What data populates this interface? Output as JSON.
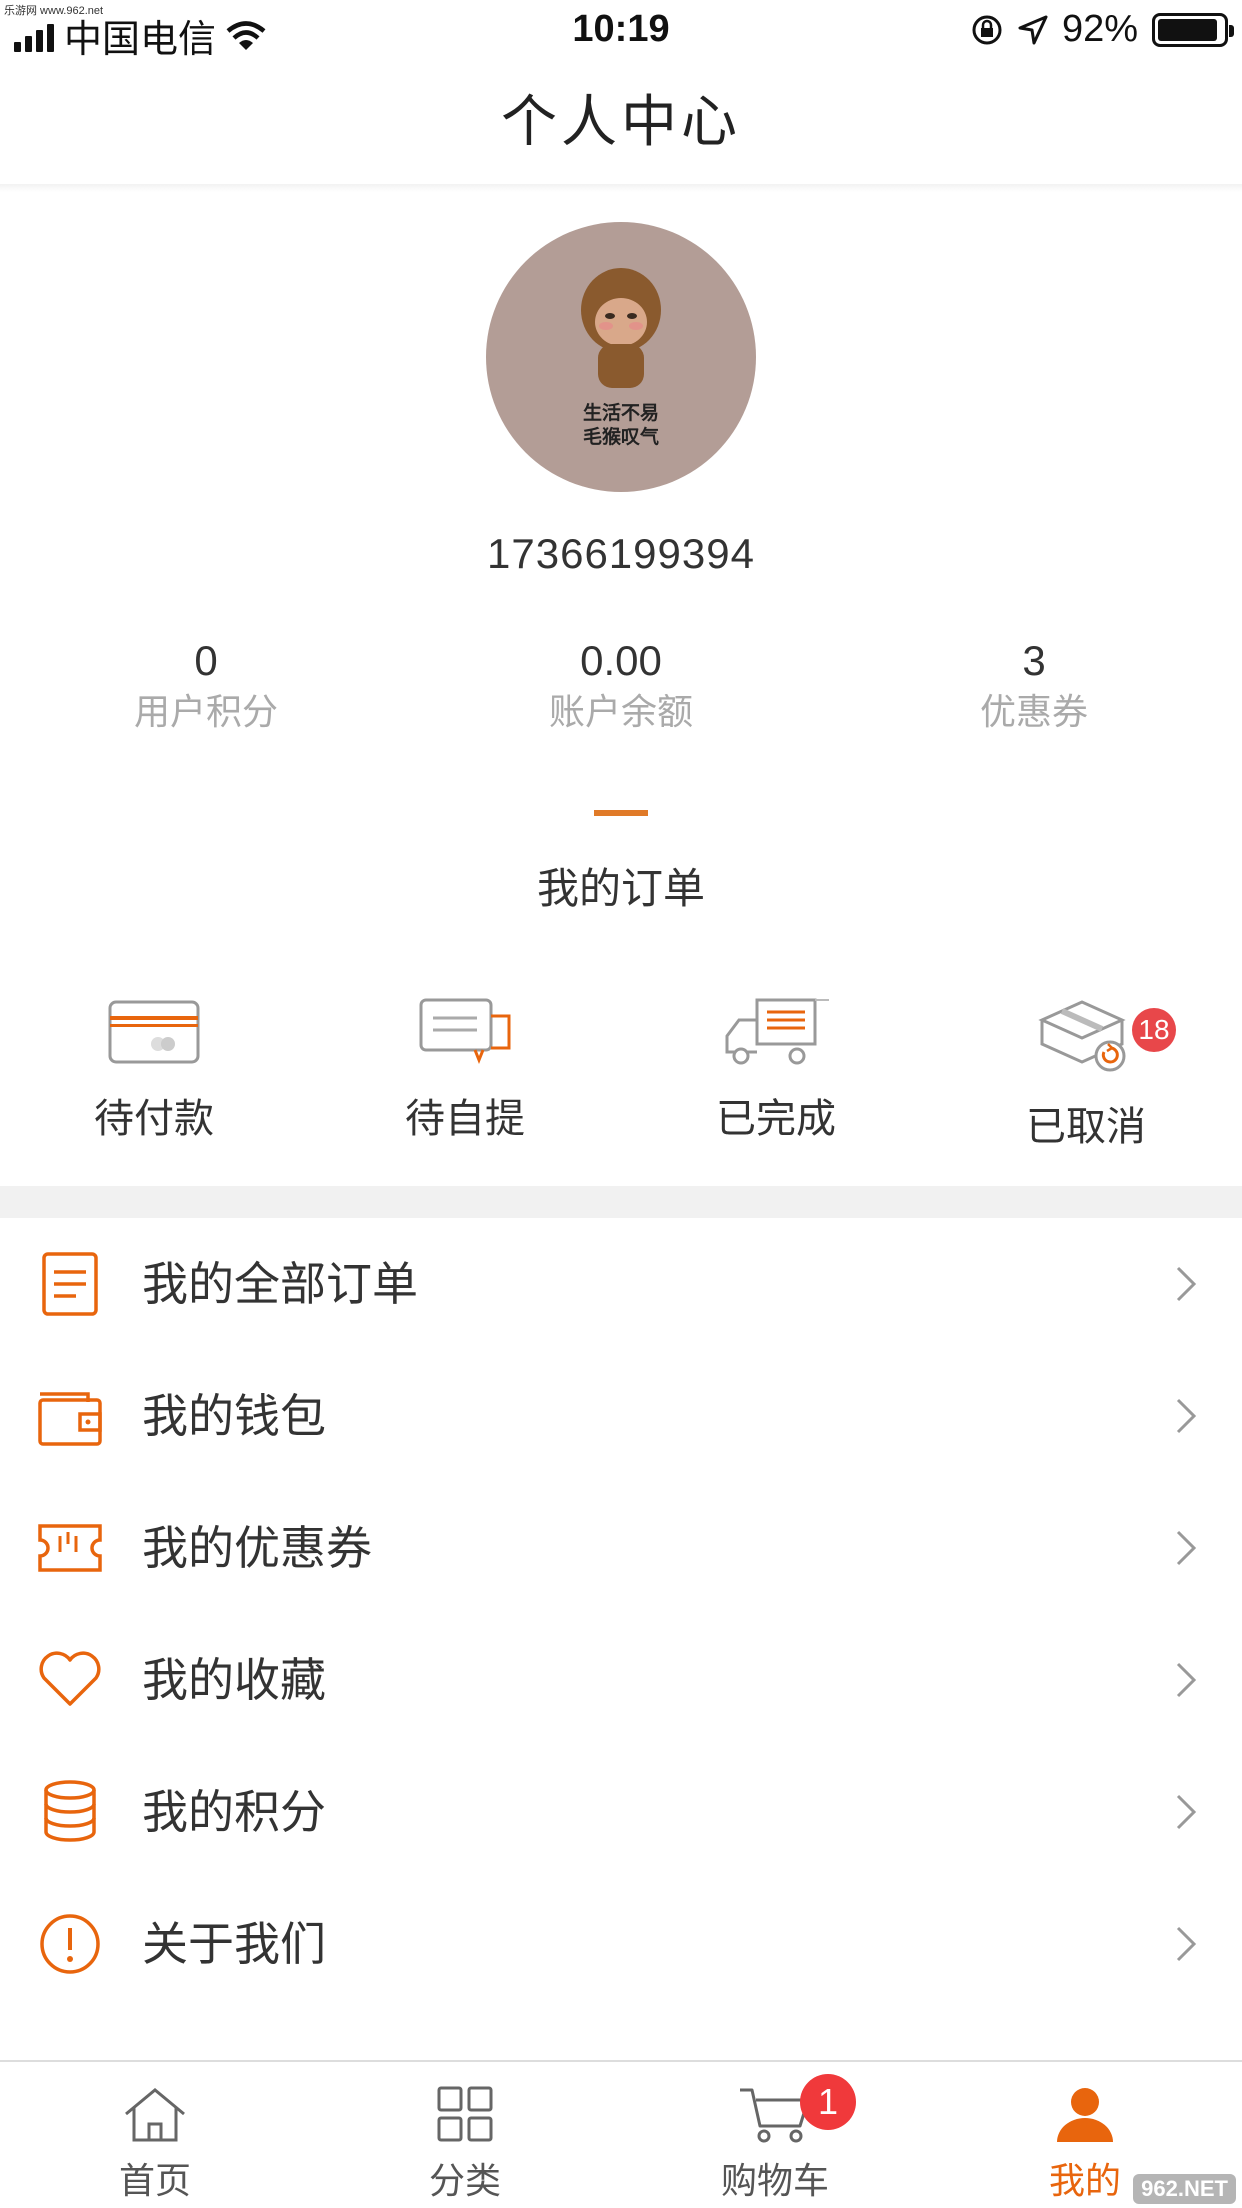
{
  "status_bar": {
    "watermark": "乐游网 www.962.net",
    "carrier": "中国电信",
    "time": "10:19",
    "battery": "92%",
    "battery_level": 0.92
  },
  "nav": {
    "title": "个人中心"
  },
  "profile": {
    "avatar_caption_line1": "生活不易",
    "avatar_caption_line2": "毛猴叹气",
    "phone": "17366199394"
  },
  "stats": [
    {
      "value": "0",
      "label": "用户积分"
    },
    {
      "value": "0.00",
      "label": "账户余额"
    },
    {
      "value": "3",
      "label": "优惠券"
    }
  ],
  "orders": {
    "title": "我的订单",
    "items": [
      {
        "label": "待付款",
        "icon": "card-icon"
      },
      {
        "label": "待自提",
        "icon": "chat-icon"
      },
      {
        "label": "已完成",
        "icon": "truck-icon"
      },
      {
        "label": "已取消",
        "icon": "box-icon",
        "badge": "18"
      }
    ]
  },
  "menu": [
    {
      "label": "我的全部订单",
      "icon": "document-icon"
    },
    {
      "label": "我的钱包",
      "icon": "wallet-icon"
    },
    {
      "label": "我的优惠券",
      "icon": "ticket-icon"
    },
    {
      "label": "我的收藏",
      "icon": "heart-icon"
    },
    {
      "label": "我的积分",
      "icon": "coins-icon"
    },
    {
      "label": "关于我们",
      "icon": "info-icon"
    }
  ],
  "tabbar": {
    "tabs": [
      {
        "label": "首页",
        "icon": "home-icon"
      },
      {
        "label": "分类",
        "icon": "grid-icon"
      },
      {
        "label": "购物车",
        "icon": "cart-icon",
        "badge": "1"
      },
      {
        "label": "我的",
        "icon": "user-icon",
        "active": true
      }
    ],
    "watermark": "962.NET"
  },
  "colors": {
    "accent": "#e8650d",
    "badge": "#e8474a",
    "muted": "#aaaaaa"
  }
}
